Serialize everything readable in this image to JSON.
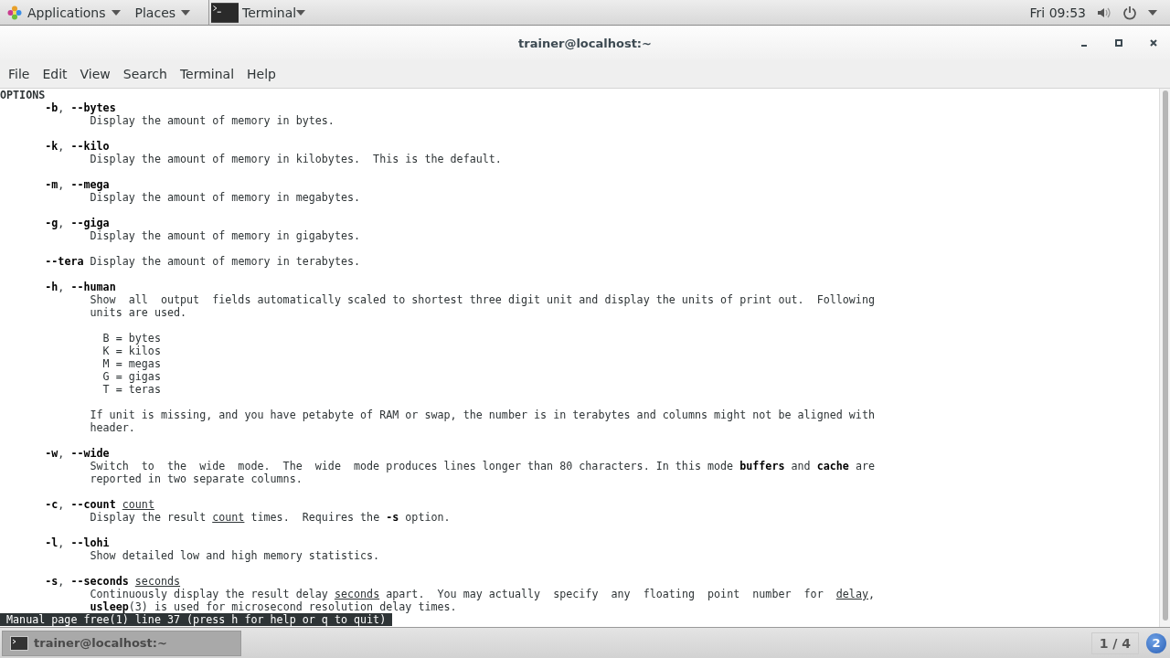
{
  "top_bar": {
    "applications": "Applications",
    "places": "Places",
    "app_name": "Terminal",
    "clock": "Fri 09:53"
  },
  "window": {
    "title": "trainer@localhost:~"
  },
  "menu": [
    "File",
    "Edit",
    "View",
    "Search",
    "Terminal",
    "Help"
  ],
  "terminal": {
    "section_heading": "OPTIONS",
    "paragraphs": [
      [
        "       **-b**, **--bytes**",
        "              Display the amount of memory in bytes."
      ],
      [
        "       **-k**, **--kilo**",
        "              Display the amount of memory in kilobytes.  This is the default."
      ],
      [
        "       **-m**, **--mega**",
        "              Display the amount of memory in megabytes."
      ],
      [
        "       **-g**, **--giga**",
        "              Display the amount of memory in gigabytes."
      ],
      [
        "       **--tera** Display the amount of memory in terabytes."
      ],
      [
        "       **-h**, **--human**",
        "              Show  all  output  fields automatically scaled to shortest three digit unit and display the units of print out.  Following",
        "              units are used."
      ],
      [
        "                B = bytes",
        "                K = kilos",
        "                M = megas",
        "                G = gigas",
        "                T = teras"
      ],
      [
        "              If unit is missing, and you have petabyte of RAM or swap, the number is in terabytes and columns might not be aligned with",
        "              header."
      ],
      [
        "       **-w**, **--wide**",
        "              Switch  to  the  wide  mode.  The  wide  mode produces lines longer than 80 characters. In this mode **buffers** and **cache** are",
        "              reported in two separate columns."
      ],
      [
        "       **-c**, **--count** *count*",
        "              Display the result *count* times.  Requires the **-s** option."
      ],
      [
        "       **-l**, **--lohi**",
        "              Show detailed low and high memory statistics."
      ],
      [
        "       **-s**, **--seconds** *seconds*",
        "              Continuously display the result delay *seconds* apart.  You may actually  specify  any  floating  point  number  for  *delay*,",
        "              **usleep**(3) is used for microsecond resolution delay times."
      ]
    ],
    "status_line": " Manual page free(1) line 37 (press h for help or q to quit) "
  },
  "taskbar": {
    "window_button": "trainer@localhost:~",
    "workspace": "1 / 4",
    "notification_count": "2"
  }
}
